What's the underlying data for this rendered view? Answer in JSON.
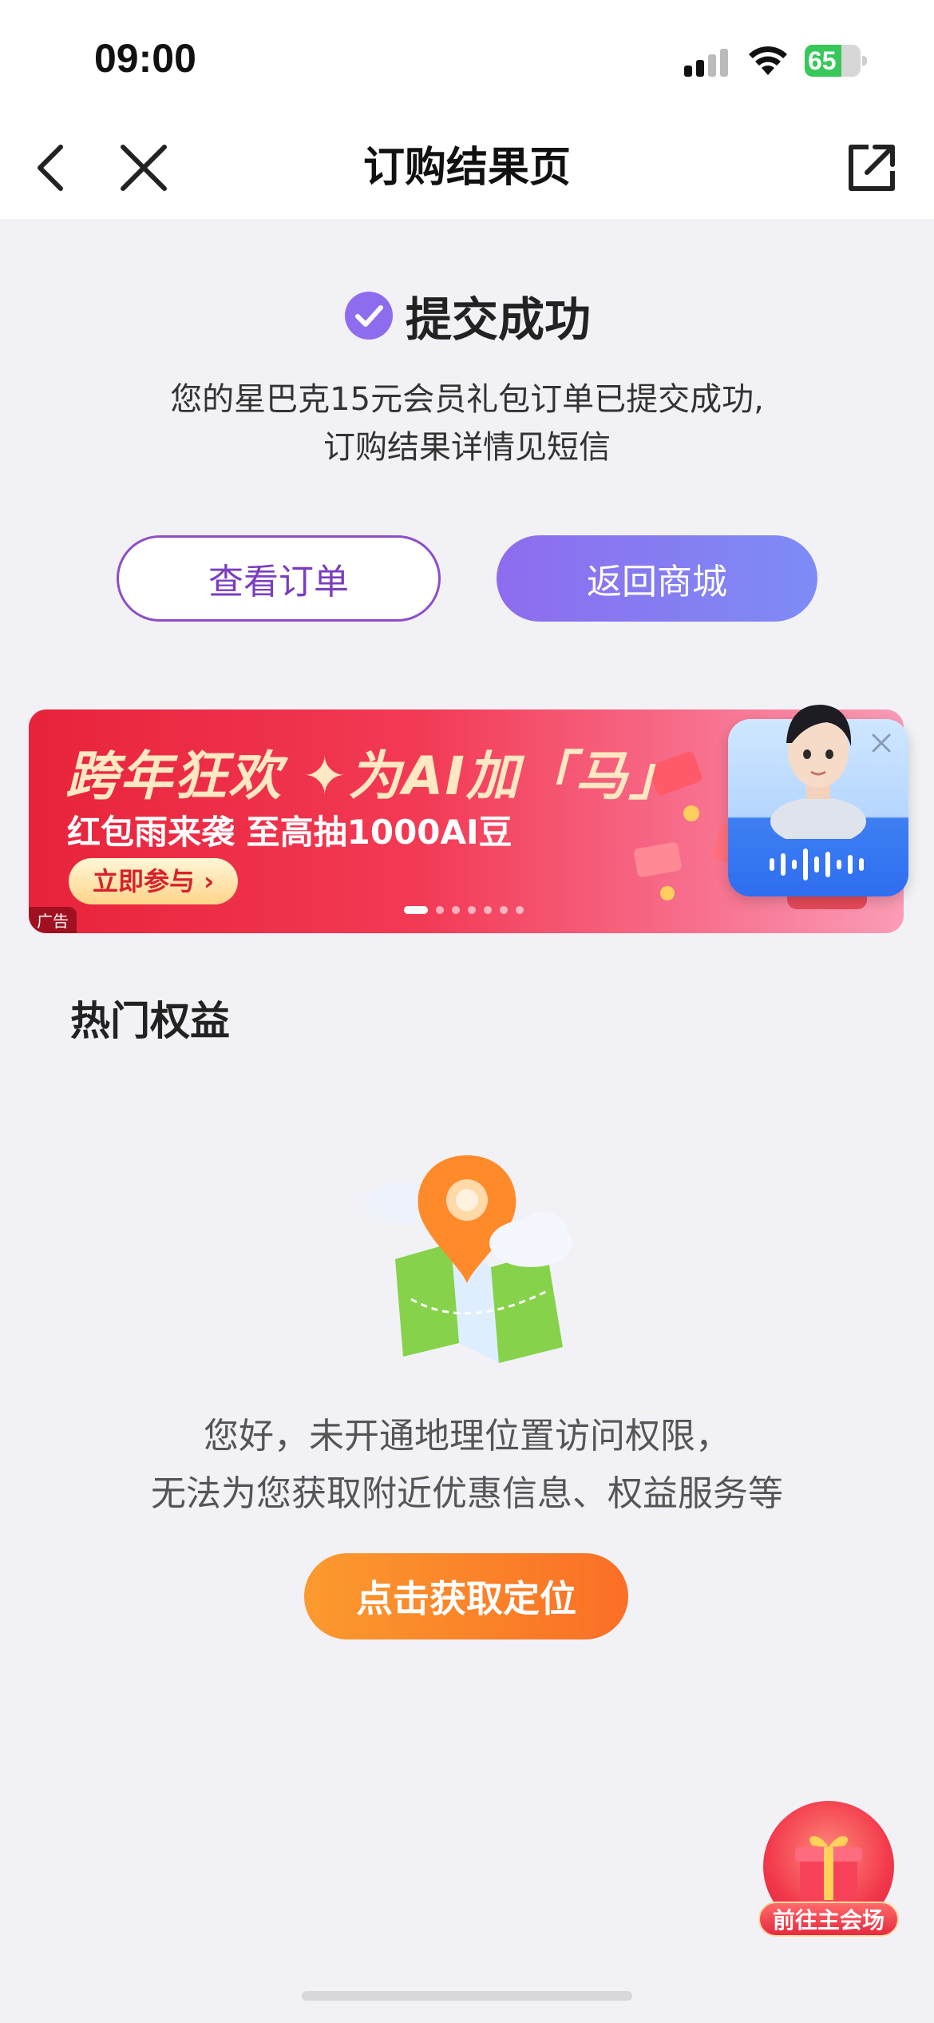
{
  "status_bar": {
    "time": "09:00",
    "battery": "65",
    "battery_level": 0.65
  },
  "nav": {
    "title": "订购结果页"
  },
  "result": {
    "title": "提交成功",
    "desc_line1": "您的星巴克15元会员礼包订单已提交成功,",
    "desc_line2": "订购结果详情见短信",
    "view_order_label": "查看订单",
    "return_store_label": "返回商城"
  },
  "banner": {
    "headline": "跨年狂欢 ✦为AI加「马」",
    "subline": "红包雨来袭 至高抽1000AI豆",
    "cta": "立即参与 ›",
    "ad_tag": "广告",
    "slide_count": 7,
    "active_slide": 1
  },
  "hot_benefits": {
    "title": "热门权益",
    "message_line1": "您好，未开通地理位置访问权限，",
    "message_line2": "无法为您获取附近优惠信息、权益服务等",
    "locate_button": "点击获取定位"
  },
  "floating": {
    "venue_label": "前往主会场"
  },
  "colors": {
    "accent_purple": "#8c4fc9",
    "accent_orange": "#fb7a2a",
    "banner_red": "#e8233b"
  }
}
